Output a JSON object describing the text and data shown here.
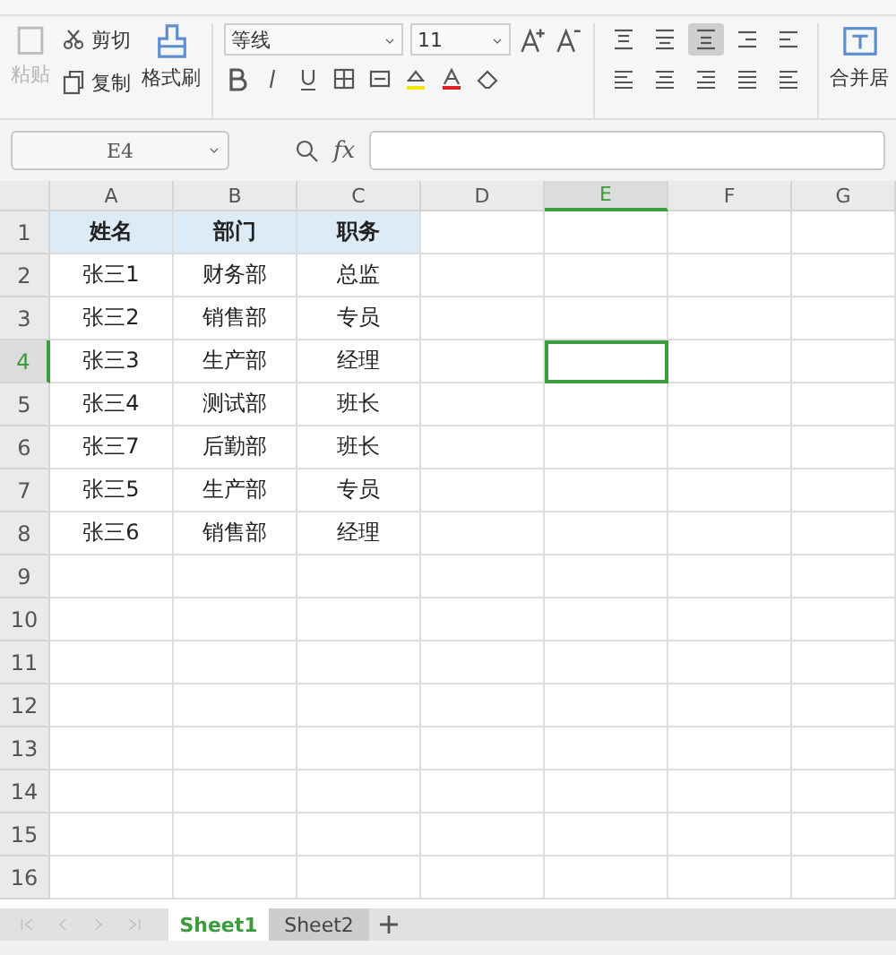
{
  "ribbon": {
    "paste": "粘贴",
    "cut": "剪切",
    "copy": "复制",
    "format_painter": "格式刷",
    "font_family": "等线",
    "font_size": "11",
    "merge": "合并居",
    "align_buttons": [
      {
        "kind": "top",
        "selected": false
      },
      {
        "kind": "middle",
        "selected": false
      },
      {
        "kind": "bottom",
        "selected": true
      },
      {
        "kind": "indent-left",
        "selected": false
      },
      {
        "kind": "indent-right",
        "selected": false
      }
    ]
  },
  "name_box": "E4",
  "formula_label": "fx",
  "columns": [
    {
      "label": "A",
      "selected": false
    },
    {
      "label": "B",
      "selected": false
    },
    {
      "label": "C",
      "selected": false
    },
    {
      "label": "D",
      "selected": false
    },
    {
      "label": "E",
      "selected": true
    },
    {
      "label": "F",
      "selected": false
    },
    {
      "label": "G",
      "selected": false
    }
  ],
  "rows": [
    {
      "number": "1",
      "selected": false,
      "kind": "header",
      "cells": [
        "姓名",
        "部门",
        "职务"
      ]
    },
    {
      "number": "2",
      "selected": false,
      "kind": "data",
      "cells": [
        "张三1",
        "财务部",
        "总监"
      ]
    },
    {
      "number": "3",
      "selected": false,
      "kind": "data",
      "cells": [
        "张三2",
        "销售部",
        "专员"
      ]
    },
    {
      "number": "4",
      "selected": true,
      "kind": "data",
      "cells": [
        "张三3",
        "生产部",
        "经理"
      ]
    },
    {
      "number": "5",
      "selected": false,
      "kind": "data",
      "cells": [
        "张三4",
        "测试部",
        "班长"
      ]
    },
    {
      "number": "6",
      "selected": false,
      "kind": "data",
      "cells": [
        "张三7",
        "后勤部",
        "班长"
      ]
    },
    {
      "number": "7",
      "selected": false,
      "kind": "data",
      "cells": [
        "张三5",
        "生产部",
        "专员"
      ]
    },
    {
      "number": "8",
      "selected": false,
      "kind": "data",
      "cells": [
        "张三6",
        "销售部",
        "经理"
      ]
    },
    {
      "number": "9",
      "selected": false,
      "kind": "data"
    },
    {
      "number": "10",
      "selected": false,
      "kind": "data"
    },
    {
      "number": "11",
      "selected": false,
      "kind": "data"
    },
    {
      "number": "12",
      "selected": false,
      "kind": "data"
    },
    {
      "number": "13",
      "selected": false,
      "kind": "data"
    },
    {
      "number": "14",
      "selected": false,
      "kind": "data"
    },
    {
      "number": "15",
      "selected": false,
      "kind": "data"
    },
    {
      "number": "16",
      "selected": false,
      "kind": "data"
    }
  ],
  "sheet_tabs": [
    {
      "label": "Sheet1",
      "selected": true
    },
    {
      "label": "Sheet2",
      "selected": false
    }
  ]
}
